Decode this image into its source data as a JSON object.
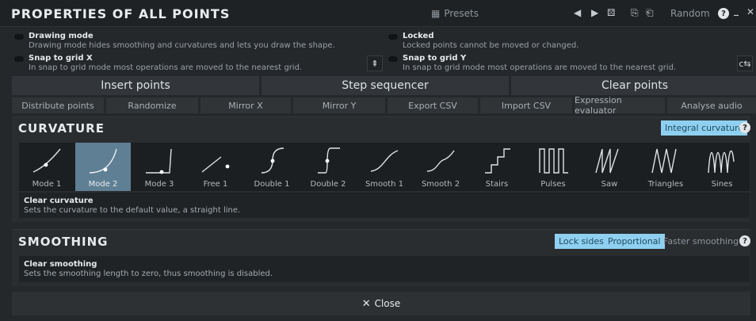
{
  "titlebar": {
    "title": "PROPERTIES OF ALL POINTS",
    "presets_label": "Presets",
    "random_label": "Random",
    "help": "?",
    "minimize": "_",
    "close": "✕"
  },
  "options": {
    "drawing_mode": {
      "name": "Drawing mode",
      "desc": "Drawing mode hides smoothing and curvatures and lets you draw the shape."
    },
    "snap_x": {
      "name": "Snap to grid X",
      "desc": "In snap to grid mode most operations are moved to the nearest grid."
    },
    "locked": {
      "name": "Locked",
      "desc": "Locked points cannot be moved or changed."
    },
    "snap_y": {
      "name": "Snap to grid Y",
      "desc": "In snap to grid mode most operations are moved to the nearest grid."
    }
  },
  "big_buttons": [
    "Insert points",
    "Step sequencer",
    "Clear points"
  ],
  "small_buttons": [
    "Distribute points",
    "Randomize",
    "Mirror X",
    "Mirror Y",
    "Export CSV",
    "Import CSV",
    "Expression evaluator",
    "Analyse audio"
  ],
  "curvature": {
    "title": "CURVATURE",
    "integral_label": "Integral curvature",
    "modes": [
      "Mode 1",
      "Mode 2",
      "Mode 3",
      "Free 1",
      "Double 1",
      "Double 2",
      "Smooth 1",
      "Smooth 2",
      "Stairs",
      "Pulses",
      "Saw",
      "Triangles",
      "Sines"
    ],
    "selected_index": 1,
    "info_title": "Clear curvature",
    "info_desc": "Sets the curvature to the default value, a straight line."
  },
  "smoothing": {
    "title": "SMOOTHING",
    "lock_sides": "Lock sides",
    "proportional": "Proportional",
    "faster": "Faster smoothing",
    "info_title": "Clear smoothing",
    "info_desc": "Sets the smoothing length to zero, thus smoothing is disabled."
  },
  "footer": {
    "close_label": "Close"
  }
}
